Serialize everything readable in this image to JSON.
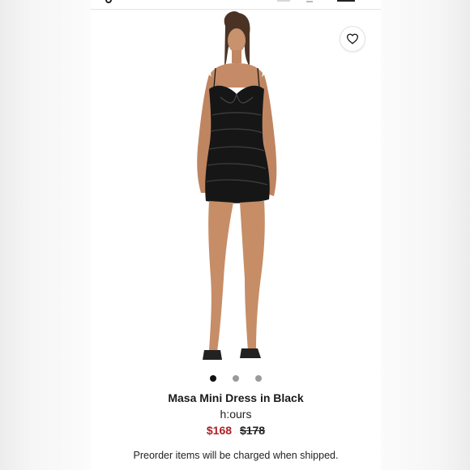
{
  "product": {
    "name": "Masa Mini Dress in Black",
    "brand": "h:ours",
    "sale_price": "$168",
    "original_price": "$178",
    "preorder_note": "Preorder items will be charged when shipped."
  },
  "gallery": {
    "image_count": 3,
    "active_index": 0
  },
  "icons": {
    "wishlist": "heart-icon",
    "search": "search-icon",
    "bag": "bag-icon",
    "account": "user-icon",
    "menu": "menu-icon"
  },
  "colors": {
    "sale_price": "#b01e23",
    "dot_active": "#111111",
    "dot_inactive": "#9a9a9a",
    "dress": "#161616"
  }
}
